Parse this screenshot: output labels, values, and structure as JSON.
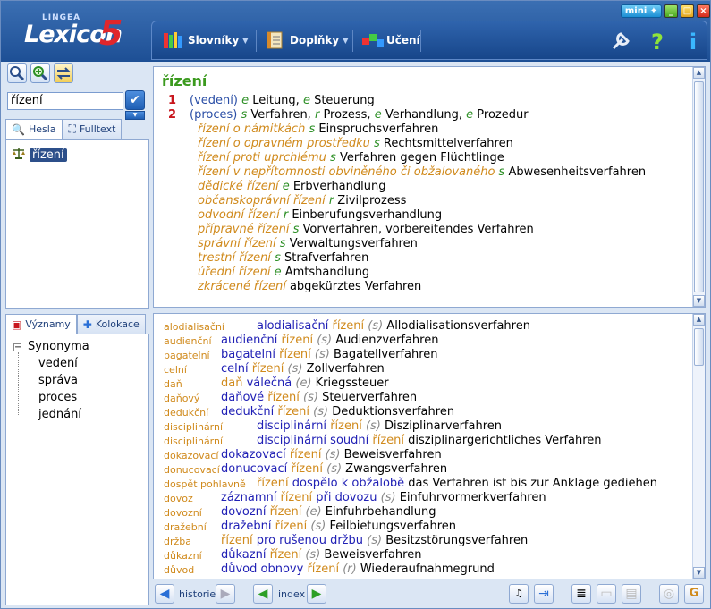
{
  "app": {
    "brand_small": "LINGEA",
    "brand": "Lexicon",
    "brand_num": "5"
  },
  "window": {
    "mini_label": "mini ✦"
  },
  "menu": {
    "slovniky": "Slovníky",
    "doplnky": "Doplňky",
    "uceni": "Učení"
  },
  "search": {
    "value": "řízení"
  },
  "tabs_top": {
    "hesla": "Hesla",
    "fulltext": "Fulltext"
  },
  "hesla": {
    "item": "řízení"
  },
  "tabs_bottom": {
    "vyznamy": "Významy",
    "kolokace": "Kolokace"
  },
  "synonyma": {
    "root": "Synonyma",
    "items": [
      "vedení",
      "správa",
      "proces",
      "jednání"
    ]
  },
  "entry": {
    "headword": "řízení",
    "senses": [
      {
        "num": "1",
        "qual": "(vedení)",
        "parts": [
          [
            "e",
            "Leitung, "
          ],
          [
            "e",
            "Steuerung"
          ]
        ]
      },
      {
        "num": "2",
        "qual": "(proces)",
        "parts": [
          [
            "s",
            "Verfahren, "
          ],
          [
            "r",
            "Prozess, "
          ],
          [
            "e",
            "Verhandlung, "
          ],
          [
            "e",
            "Prozedur"
          ]
        ]
      }
    ],
    "phrases": [
      {
        "cz": "řízení o námitkách",
        "g": "s",
        "de": "Einspruchsverfahren"
      },
      {
        "cz": "řízení o opravném prostředku",
        "g": "s",
        "de": "Rechtsmittelverfahren"
      },
      {
        "cz": "řízení proti uprchlému",
        "g": "s",
        "de": "Verfahren gegen Flüchtlinge"
      },
      {
        "cz": "řízení v nepřítomnosti obviněného či obžalovaného",
        "g": "s",
        "de": "Abwesenheitsverfahren"
      },
      {
        "cz": "dědické řízení",
        "g": "e",
        "de": "Erbverhandlung"
      },
      {
        "cz": "občanskoprávní řízení",
        "g": "r",
        "de": "Zivilprozess"
      },
      {
        "cz": "odvodní řízení",
        "g": "r",
        "de": "Einberufungsverhandlung"
      },
      {
        "cz": "přípravné řízení",
        "g": "s",
        "de": "Vorverfahren, vorbereitendes Verfahren"
      },
      {
        "cz": "správní řízení",
        "g": "s",
        "de": "Verwaltungsverfahren"
      },
      {
        "cz": "trestní řízení",
        "g": "s",
        "de": "Strafverfahren"
      },
      {
        "cz": "úřední řízení",
        "g": "e",
        "de": "Amtshandlung"
      },
      {
        "cz": "zkrácené řízení",
        "g": "",
        "de": "abgekürztes Verfahren"
      }
    ]
  },
  "kolokace": [
    {
      "key": "alodialisační",
      "b1": "alodialisační",
      "o": "řízení",
      "b2": "",
      "pos": "(s)",
      "de": "Allodialisationsverfahren"
    },
    {
      "key": "audienční",
      "b1": "audienční",
      "o": "řízení",
      "b2": "",
      "pos": "(s)",
      "de": "Audienzverfahren"
    },
    {
      "key": "bagatelní",
      "b1": "bagatelní",
      "o": "řízení",
      "b2": "",
      "pos": "(s)",
      "de": "Bagatellverfahren"
    },
    {
      "key": "celní",
      "b1": "celní",
      "o": "řízení",
      "b2": "",
      "pos": "(s)",
      "de": "Zollverfahren"
    },
    {
      "key": "daň",
      "b1": "",
      "o": "daň",
      "b2": "válečná",
      "pos": "(e)",
      "de": "Kriegssteuer"
    },
    {
      "key": "daňový",
      "b1": "daňové",
      "o": "řízení",
      "b2": "",
      "pos": "(s)",
      "de": "Steuerverfahren"
    },
    {
      "key": "dedukční",
      "b1": "dedukční",
      "o": "řízení",
      "b2": "",
      "pos": "(s)",
      "de": "Deduktionsverfahren"
    },
    {
      "key": "disciplinární",
      "b1": "disciplinární",
      "o": "řízení",
      "b2": "",
      "pos": "(s)",
      "de": "Disziplinarverfahren"
    },
    {
      "key": "disciplinární",
      "b1": "disciplinární soudní",
      "o": "řízení",
      "b2": "",
      "pos": "",
      "de": "disziplinargerichtliches Verfahren"
    },
    {
      "key": "dokazovací",
      "b1": "dokazovací",
      "o": "řízení",
      "b2": "",
      "pos": "(s)",
      "de": "Beweisverfahren"
    },
    {
      "key": "donucovací",
      "b1": "donucovací",
      "o": "řízení",
      "b2": "",
      "pos": "(s)",
      "de": "Zwangsverfahren"
    },
    {
      "key": "dospět pohlavně",
      "b1": "",
      "o": "řízení",
      "b2": "dospělo k obžalobě",
      "pos": "",
      "de": "das Verfahren ist bis zur Anklage gediehen"
    },
    {
      "key": "dovoz",
      "b1": "záznamní",
      "o": "řízení",
      "b2": "při dovozu",
      "pos": "(s)",
      "de": "Einfuhrvormerkverfahren"
    },
    {
      "key": "dovozní",
      "b1": "dovozní",
      "o": "řízení",
      "b2": "",
      "pos": "(e)",
      "de": "Einfuhrbehandlung"
    },
    {
      "key": "dražební",
      "b1": "dražební",
      "o": "řízení",
      "b2": "",
      "pos": "(s)",
      "de": "Feilbietungsverfahren"
    },
    {
      "key": "držba",
      "b1": "",
      "o": "řízení",
      "b2": "pro rušenou držbu",
      "pos": "(s)",
      "de": "Besitzstörungsverfahren"
    },
    {
      "key": "důkazní",
      "b1": "důkazní",
      "o": "řízení",
      "b2": "",
      "pos": "(s)",
      "de": "Beweisverfahren"
    },
    {
      "key": "důvod",
      "b1": "důvod obnovy",
      "o": "řízení",
      "b2": "",
      "pos": "(r)",
      "de": "Wiederaufnahmegrund"
    }
  ],
  "bottom": {
    "historie": "historie",
    "index": "index"
  },
  "colors": {
    "accent": "#1d4f95",
    "headword": "#3b9a1e",
    "sense_num": "#c8161d",
    "phrase": "#d08a1c",
    "collocation": "#2020b5"
  }
}
